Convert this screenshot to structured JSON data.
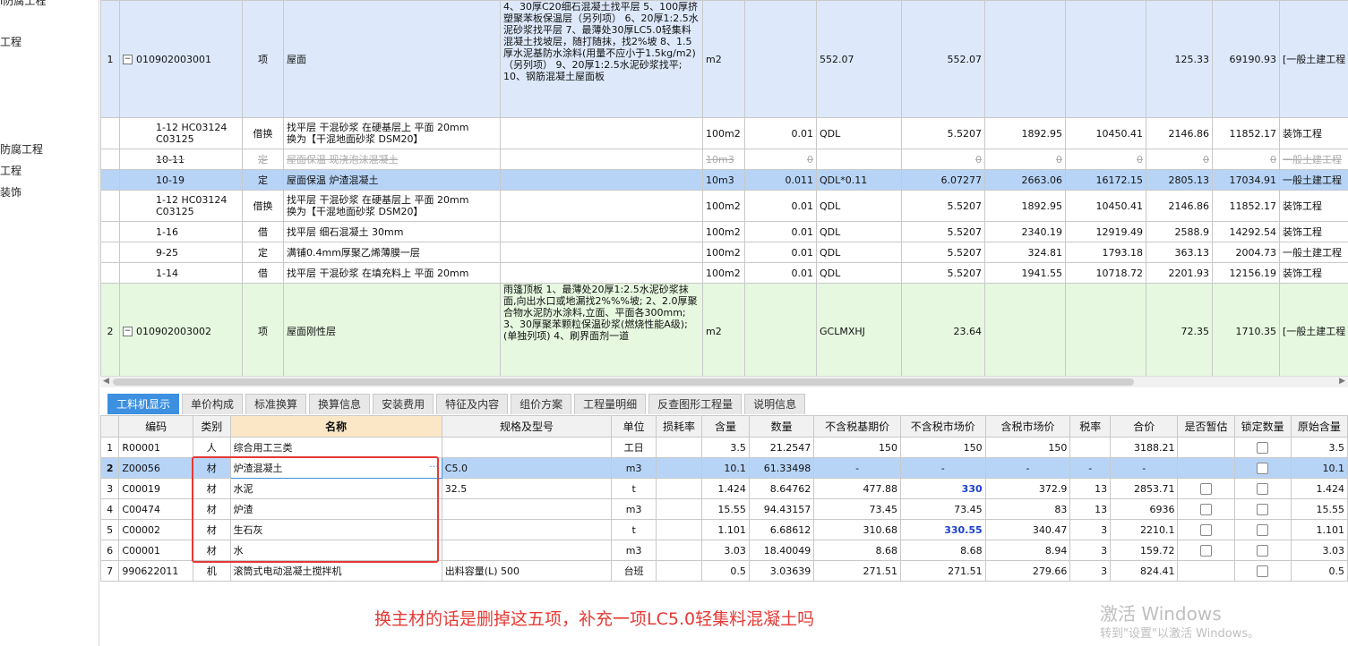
{
  "sidebar": {
    "items": [
      "l防腐工程",
      "工程",
      "防腐工程",
      "工程",
      "装饰"
    ]
  },
  "upper_rows": [
    {
      "type": "qd",
      "num": "1",
      "code": "010902003001",
      "kind": "项",
      "name": "屋面",
      "desc": "4、30厚C20细石混凝土找平层\n5、100厚挤塑聚苯板保温层（另列项）\n6、20厚1:2.5水泥砂浆找平层\n7、最薄处30厚LC5.0轻集料混凝土找坡层，随打随抹，找2%坡\n8、1.5厚水泥基防水涂料(用量不应小于1.5kg/m2)（另列项）\n9、20厚1:2.5水泥砂浆找平;\n10、钢筋混凝土屋面板",
      "unit": "m2",
      "content": "",
      "expr": "552.07",
      "qty": "552.07",
      "price": "",
      "total": "",
      "u1": "125.33",
      "u2": "69190.93",
      "prof": "[一般土建工程"
    },
    {
      "type": "de",
      "num": "",
      "code": "1-12 HC03124\nC03125",
      "kind": "借换",
      "name": "找平层 干混砂浆 在硬基层上 平面 20mm\n换为【干混地面砂浆 DSM20】",
      "desc": "",
      "unit": "100m2",
      "content": "0.01",
      "expr": "QDL",
      "qty": "5.5207",
      "price": "1892.95",
      "total": "10450.41",
      "u1": "2146.86",
      "u2": "11852.17",
      "prof": "装饰工程"
    },
    {
      "type": "del",
      "num": "",
      "code": "10-11",
      "kind": "定",
      "name": "屋面保温 现浇泡沫混凝土",
      "desc": "",
      "unit": "10m3",
      "content": "0",
      "expr": "",
      "qty": "0",
      "price": "0",
      "total": "0",
      "u1": "0",
      "u2": "0",
      "prof": "一般土建工程"
    },
    {
      "type": "sel",
      "num": "",
      "code": "10-19",
      "kind": "定",
      "name": "屋面保温 炉渣混凝土",
      "desc": "",
      "unit": "10m3",
      "content": "0.011",
      "expr": "QDL*0.11",
      "qty": "6.07277",
      "price": "2663.06",
      "total": "16172.15",
      "u1": "2805.13",
      "u2": "17034.91",
      "prof": "一般土建工程"
    },
    {
      "type": "de",
      "num": "",
      "code": "1-12 HC03124\nC03125",
      "kind": "借换",
      "name": "找平层 干混砂浆 在硬基层上 平面 20mm\n换为【干混地面砂浆 DSM20】",
      "desc": "",
      "unit": "100m2",
      "content": "0.01",
      "expr": "QDL",
      "qty": "5.5207",
      "price": "1892.95",
      "total": "10450.41",
      "u1": "2146.86",
      "u2": "11852.17",
      "prof": "装饰工程"
    },
    {
      "type": "de",
      "num": "",
      "code": "1-16",
      "kind": "借",
      "name": "找平层 细石混凝土 30mm",
      "desc": "",
      "unit": "100m2",
      "content": "0.01",
      "expr": "QDL",
      "qty": "5.5207",
      "price": "2340.19",
      "total": "12919.49",
      "u1": "2588.9",
      "u2": "14292.54",
      "prof": "装饰工程"
    },
    {
      "type": "de",
      "num": "",
      "code": "9-25",
      "kind": "定",
      "name": "满铺0.4mm厚聚乙烯薄膜一层",
      "desc": "",
      "unit": "100m2",
      "content": "0.01",
      "expr": "QDL",
      "qty": "5.5207",
      "price": "324.81",
      "total": "1793.18",
      "u1": "363.13",
      "u2": "2004.73",
      "prof": "一般土建工程"
    },
    {
      "type": "de",
      "num": "",
      "code": "1-14",
      "kind": "借",
      "name": "找平层 干混砂浆 在填充料上 平面 20mm",
      "desc": "",
      "unit": "100m2",
      "content": "0.01",
      "expr": "QDL",
      "qty": "5.5207",
      "price": "1941.55",
      "total": "10718.72",
      "u1": "2201.93",
      "u2": "12156.19",
      "prof": "装饰工程"
    },
    {
      "type": "qd2",
      "num": "2",
      "code": "010902003002",
      "kind": "项",
      "name": "屋面刚性层",
      "desc": "雨篷顶板\n1、最薄处20厚1:2.5水泥砂浆抹面,向出水口或地漏找2%%%坡;\n2、2.0厚聚合物水泥防水涂料,立面、平面各300mm;\n3、30厚聚苯颗粒保温砂浆(燃烧性能A级);(单独列项)\n4、刷界面剂一道",
      "unit": "m2",
      "content": "",
      "expr": "GCLMXHJ",
      "qty": "23.64",
      "price": "",
      "total": "",
      "u1": "72.35",
      "u2": "1710.35",
      "prof": "[一般土建工程"
    }
  ],
  "tabs": [
    "工料机显示",
    "单价构成",
    "标准换算",
    "换算信息",
    "安装费用",
    "特征及内容",
    "组价方案",
    "工程量明细",
    "反查图形工程量",
    "说明信息"
  ],
  "lower_headers": [
    "",
    "编码",
    "类别",
    "名称",
    "规格及型号",
    "单位",
    "损耗率",
    "含量",
    "数量",
    "不含税基期价",
    "不含税市场价",
    "含税市场价",
    "税率",
    "合价",
    "是否暂估",
    "锁定数量",
    "原始含量"
  ],
  "lower_rows": [
    {
      "n": "1",
      "code": "R00001",
      "cat": "人",
      "name": "综合用工三类",
      "spec": "",
      "unit": "工日",
      "loss": "",
      "content": "3.5",
      "qty": "21.2547",
      "base": "150",
      "market": "150",
      "taxmkt": "150",
      "rate": "",
      "total": "3188.21",
      "est": false,
      "lock": true,
      "orig": "3.5"
    },
    {
      "n": "2",
      "code": "Z00056",
      "cat": "材",
      "name": "炉渣混凝土",
      "spec": "C5.0",
      "unit": "m3",
      "loss": "",
      "content": "10.1",
      "qty": "61.33498",
      "base": "-",
      "market": "-",
      "taxmkt": "-",
      "rate": "-",
      "total": "-",
      "est": false,
      "lock": true,
      "orig": "10.1"
    },
    {
      "n": "3",
      "code": "C00019",
      "cat": "材",
      "name": "水泥",
      "spec": "32.5",
      "unit": "t",
      "loss": "",
      "content": "1.424",
      "qty": "8.64762",
      "base": "477.88",
      "market": "330",
      "taxmkt": "372.9",
      "rate": "13",
      "total": "2853.71",
      "est": true,
      "lock": true,
      "orig": "1.424",
      "hl": true
    },
    {
      "n": "4",
      "code": "C00474",
      "cat": "材",
      "name": "炉渣",
      "spec": "",
      "unit": "m3",
      "loss": "",
      "content": "15.55",
      "qty": "94.43157",
      "base": "73.45",
      "market": "73.45",
      "taxmkt": "83",
      "rate": "13",
      "total": "6936",
      "est": true,
      "lock": true,
      "orig": "15.55"
    },
    {
      "n": "5",
      "code": "C00002",
      "cat": "材",
      "name": "生石灰",
      "spec": "",
      "unit": "t",
      "loss": "",
      "content": "1.101",
      "qty": "6.68612",
      "base": "310.68",
      "market": "330.55",
      "taxmkt": "340.47",
      "rate": "3",
      "total": "2210.1",
      "est": true,
      "lock": true,
      "orig": "1.101",
      "hl": true
    },
    {
      "n": "6",
      "code": "C00001",
      "cat": "材",
      "name": "水",
      "spec": "",
      "unit": "m3",
      "loss": "",
      "content": "3.03",
      "qty": "18.40049",
      "base": "8.68",
      "market": "8.68",
      "taxmkt": "8.94",
      "rate": "3",
      "total": "159.72",
      "est": true,
      "lock": true,
      "orig": "3.03"
    },
    {
      "n": "7",
      "code": "990622011",
      "cat": "机",
      "name": "滚筒式电动混凝土搅拌机",
      "spec": "出料容量(L) 500",
      "unit": "台班",
      "loss": "",
      "content": "0.5",
      "qty": "3.03639",
      "base": "271.51",
      "market": "271.51",
      "taxmkt": "279.66",
      "rate": "3",
      "total": "824.41",
      "est": false,
      "lock": true,
      "orig": "0.5"
    }
  ],
  "caption": "换主材的话是删掉这五项，补充一项LC5.0轻集料混凝土吗",
  "watermark": {
    "line1": "激活 Windows",
    "line2": "转到\"设置\"以激活 Windows。"
  }
}
